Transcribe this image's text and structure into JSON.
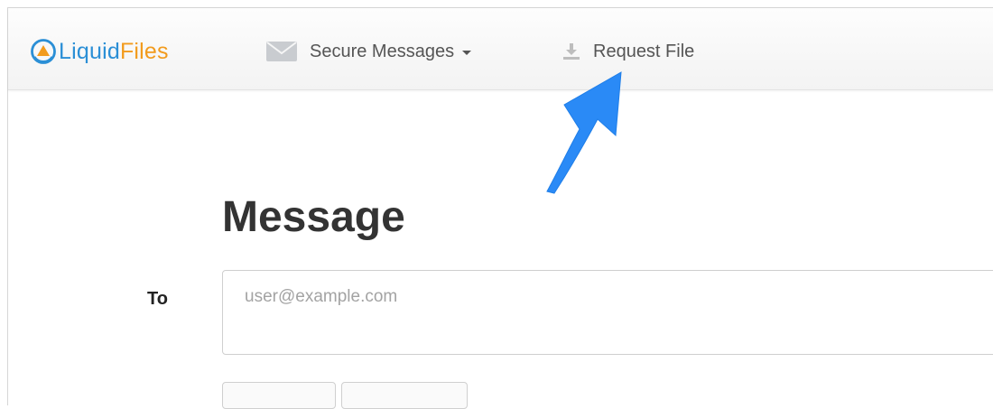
{
  "brand": {
    "name_part1": "Liquid",
    "name_part2": "Files",
    "colors": {
      "primary": "#2b8fd6",
      "accent": "#f29b1d"
    }
  },
  "nav": {
    "messages": {
      "label": "Secure Messages",
      "icon": "envelope-icon",
      "has_dropdown": true
    },
    "request_file": {
      "label": "Request File",
      "icon": "download-icon"
    }
  },
  "annotation": {
    "icon": "callout-arrow",
    "color": "#2a8af6"
  },
  "main": {
    "title": "Message",
    "to": {
      "label": "To",
      "placeholder": "user@example.com",
      "value": ""
    }
  }
}
